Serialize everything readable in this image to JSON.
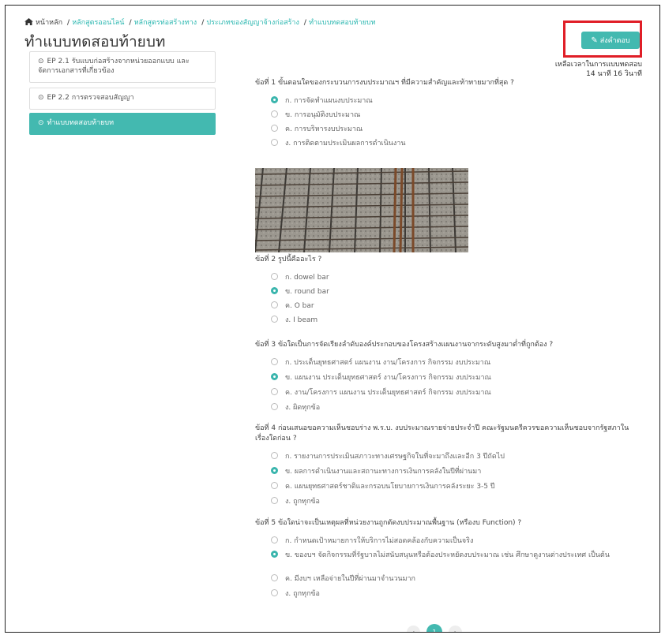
{
  "breadcrumb": {
    "home": "หน้าหลัก",
    "items": [
      "หลักสูตรออนไลน์",
      "หลักสูตรท่อสร้างทาง",
      "ประเภทของสัญญาจ้างก่อสร้าง",
      "ทำแบบทดสอบท้ายบท"
    ]
  },
  "page_title": "ทำแบบทดสอบท้ายบท",
  "submit_label": "ส่งคำตอบ",
  "timer": {
    "label": "เหลือเวลาในการแบบทดสอบ",
    "value": "14 นาที 16 วินาที"
  },
  "sidebar": {
    "items": [
      {
        "label": "EP 2.1 รับแบบก่อสร้างจากหน่วยออกแบบ และจัดการเอกสารที่เกี่ยวข้อง"
      },
      {
        "label": "EP 2.2 การตรวจสอบสัญญา"
      },
      {
        "label": "ทำแบบทดสอบท้ายบท"
      }
    ]
  },
  "questions": [
    {
      "text": "ข้อที่ 1 ขั้นตอนใดของกระบวนการงบประมาณฯ ที่มีความสำคัญและท้าทายมากที่สุด ?",
      "options": [
        "ก. การจัดทำแผนงบประมาณ",
        "ข. การอนุมัติงบประมาณ",
        "ค. การบริหารงบประมาณ",
        "ง. การติดตามประเมินผลการดำเนินงาน"
      ],
      "selected": 0
    },
    {
      "text": "ข้อที่ 2 รูปนี้คืออะไร ?",
      "options": [
        "ก. dowel bar",
        "ข. round bar",
        "ค. O bar",
        "ง. I beam"
      ],
      "selected": 1
    },
    {
      "text": "ข้อที่ 3 ข้อใดเป็นการจัดเรียงลำดับองค์ประกอบของโครงสร้างแผนงานจากระดับสูงมาต่ำที่ถูกต้อง ?",
      "options": [
        "ก. ประเด็นยุทธศาสตร์ แผนงาน งาน/โครงการ กิจกรรม งบประมาณ",
        "ข. แผนงาน ประเด็นยุทธศาสตร์ งาน/โครงการ กิจกรรม งบประมาณ",
        "ค. งาน/โครงการ แผนงาน ประเด็นยุทธศาสตร์ กิจกรรม งบประมาณ",
        "ง. ผิดทุกข้อ"
      ],
      "selected": 1
    },
    {
      "text": "ข้อที่ 4 ก่อนเสนอขอความเห็นชอบร่าง พ.ร.บ. งบประมาณรายจ่ายประจำปี คณะรัฐมนตรีควรขอความเห็นชอบจากรัฐสภาในเรื่องใดก่อน ?",
      "options": [
        "ก. รายงานการประเมินสภาวะทางเศรษฐกิจในที่จะมาถึงและอีก 3 ปีถัดไป",
        "ข. ผลการดำเนินงานและสถานะทางการเงินการคลังในปีที่ผ่านมา",
        "ค. แผนยุทธศาสตร์ชาติและกรอบนโยบายการเงินการคลังระยะ 3-5 ปี",
        "ง. ถูกทุกข้อ"
      ],
      "selected": 1
    },
    {
      "text": "ข้อที่ 5 ข้อใดน่าจะเป็นเหตุผลที่หน่วยงานถูกตัดงบประมาณพื้นฐาน (หรืองบ Function) ?",
      "options": [
        "ก. กำหนดเป้าหมายการให้บริการไม่สอดคล้องกับความเป็นจริง",
        "ข. ของบฯ จัดกิจกรรมที่รัฐบาลไม่สนับสนุนหรือต้องประหยัดงบประมาณ เช่น ศึกษาดูงานต่างประเทศ เป็นต้น",
        "ค. มีงบฯ เหลือจ่ายในปีที่ผ่านมาจำนวนมาก",
        "ง. ถูกทุกข้อ"
      ],
      "selected": 1
    }
  ],
  "pagination": {
    "prev": "‹",
    "current": "1",
    "next": "›"
  },
  "colors": {
    "accent": "#43b9b0",
    "highlight": "#e01e27"
  }
}
